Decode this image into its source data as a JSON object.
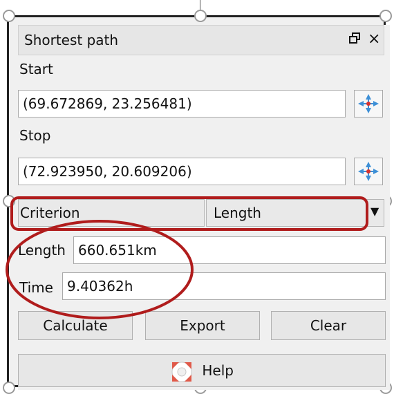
{
  "panel": {
    "title": "Shortest path",
    "float_icon": "undock-icon",
    "close_glyph": "×"
  },
  "start": {
    "label": "Start",
    "value": "(69.672869, 23.256481)"
  },
  "stop": {
    "label": "Stop",
    "value": "(72.923950, 20.609206)"
  },
  "criterion": {
    "label": "Criterion",
    "selected": "Length"
  },
  "result": {
    "length_label": "Length",
    "length_value": "660.651km",
    "time_label": "Time",
    "time_value": "9.40362h"
  },
  "buttons": {
    "calculate": "Calculate",
    "export": "Export",
    "clear": "Clear",
    "help": "Help"
  },
  "colors": {
    "annotation": "#b01c1c",
    "pick_icon": "#3d8fd6"
  }
}
